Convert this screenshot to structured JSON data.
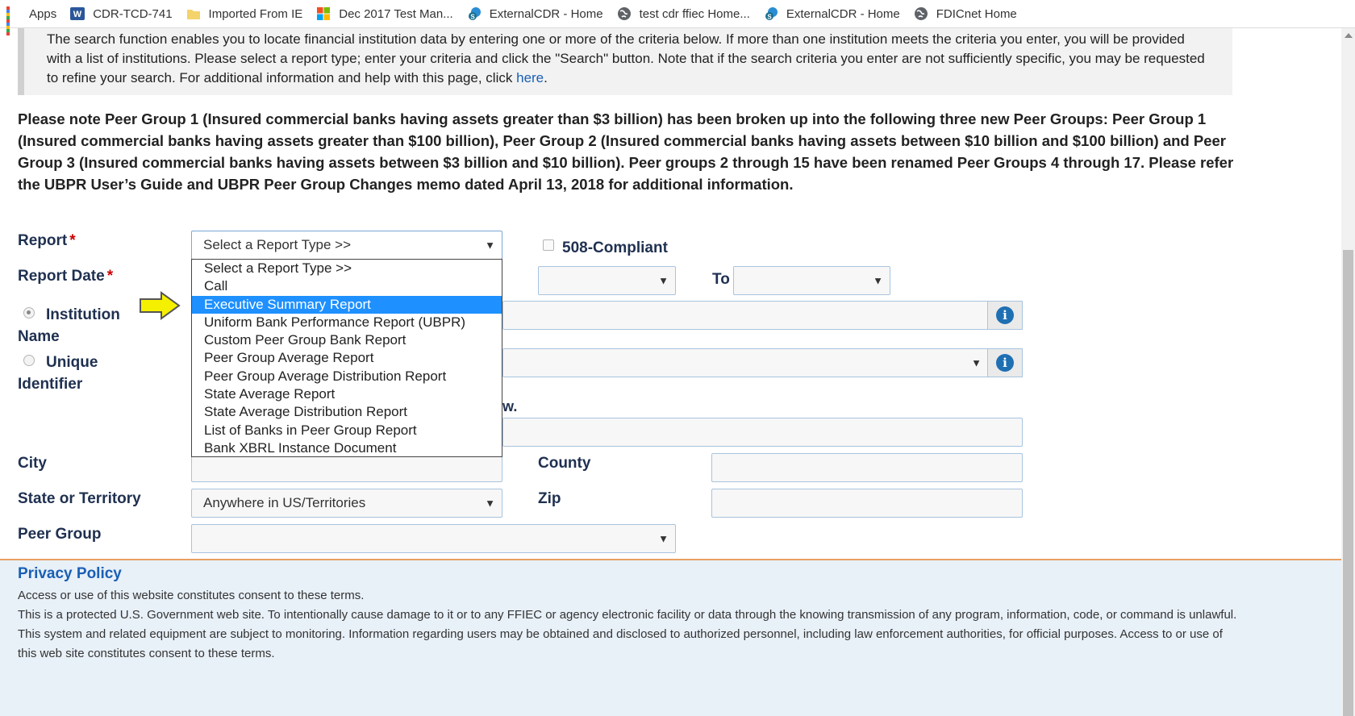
{
  "bookmarks": [
    {
      "label": "Apps",
      "icon": "apps-grid-icon"
    },
    {
      "label": "CDR-TCD-741",
      "icon": "word-doc-icon"
    },
    {
      "label": "Imported From IE",
      "icon": "folder-icon"
    },
    {
      "label": "Dec 2017 Test Man...",
      "icon": "windows-logo-icon"
    },
    {
      "label": "ExternalCDR - Home",
      "icon": "sharepoint-icon"
    },
    {
      "label": "test cdr ffiec Home...",
      "icon": "globe-icon"
    },
    {
      "label": "ExternalCDR - Home",
      "icon": "sharepoint-icon"
    },
    {
      "label": "FDICnet Home",
      "icon": "globe-icon"
    }
  ],
  "intro": {
    "text": "The search function enables you to locate financial institution data by entering one or more of the criteria below. If more than one institution meets the criteria you enter, you will be provided with a list of institutions. Please select a report type; enter your criteria and click the \"Search\" button. Note that if the search criteria you enter are not sufficiently specific, you may be requested to refine your search. For additional information and help with this page, click",
    "link": "here",
    "tail": "."
  },
  "notice": "Please note Peer Group 1 (Insured commercial banks having assets greater than $3 billion) has been broken up into the following three new Peer Groups: Peer Group 1 (Insured commercial banks having assets greater than $100 billion), Peer Group 2 (Insured commercial banks having assets between $10 billion and $100 billion) and Peer Group 3 (Insured commercial banks having assets between $3 billion and $10 billion). Peer groups 2 through 15 have been renamed Peer Groups 4 through 17. Please refer the UBPR User’s Guide and UBPR Peer Group Changes memo dated April 13, 2018 for additional information.",
  "form": {
    "report_label": "Report",
    "report_value": "Select a Report Type >>",
    "compliant_label": "508-Compliant",
    "report_date_label": "Report Date",
    "to_label": "To",
    "institution_name_label_1": "Institution",
    "institution_name_label_2": "Name",
    "unique_identifier_label_1": "Unique",
    "unique_identifier_label_2": "Identifier",
    "partial_text": "w.",
    "city_label": "City",
    "county_label": "County",
    "state_label": "State or Territory",
    "state_value": "Anywhere in US/Territories",
    "zip_label": "Zip",
    "peer_group_label": "Peer Group",
    "required_marker": "*"
  },
  "dropdown": {
    "options": [
      "Select a Report Type >>",
      "Call",
      "Executive Summary Report",
      "Uniform Bank Performance Report (UBPR)",
      "Custom Peer Group Bank Report",
      "Peer Group Average Report",
      "Peer Group Average Distribution Report",
      "State Average Report",
      "State Average Distribution Report",
      "List of Banks in Peer Group Report",
      "Bank XBRL Instance Document"
    ],
    "selected_index": 2
  },
  "footer": {
    "title": "Privacy Policy",
    "line1": "Access or use of this website constitutes consent to these terms.",
    "line2": "This is a protected U.S. Government web site. To intentionally cause damage to it or to any FFIEC or agency electronic facility or data through the knowing transmission of any program, information, code, or command is unlawful. This system and related equipment are subject to monitoring. Information regarding users may be obtained and disclosed to authorized personnel, including law enforcement authorities, for official purposes. Access to or use of this web site constitutes consent to these terms."
  },
  "colors": {
    "link": "#1a5fb4",
    "selected_option": "#1e90ff",
    "required": "#cc0000",
    "footer_border": "#e8a060",
    "arrow_indicator": "#f5f000"
  }
}
